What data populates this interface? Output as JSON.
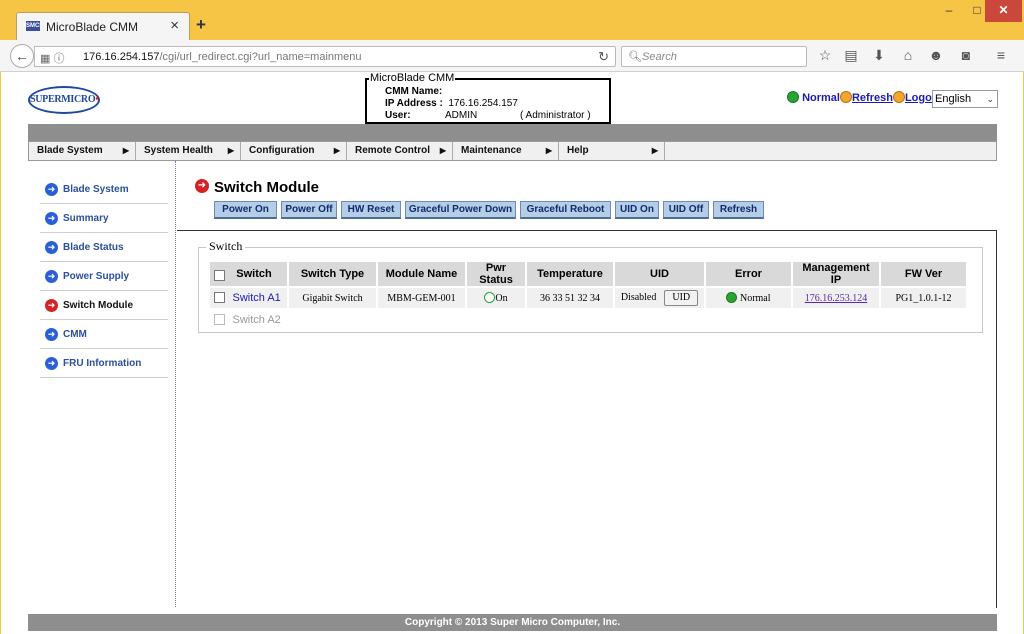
{
  "browser": {
    "tab_title": "MicroBlade CMM",
    "tab_favicon_text": "SMCI",
    "tab_close": "×",
    "new_tab": "+",
    "url_host": "176.16.254.157",
    "url_path": "/cgi/url_redirect.cgi?url_name=mainmenu",
    "search_placeholder": "Search",
    "window_controls": {
      "minimize": "–",
      "maximize": "□",
      "close": "✕"
    }
  },
  "header": {
    "logo_text": "SUPERMICRO",
    "info_legend": "MicroBlade CMM",
    "cmm_name_label": "CMM Name:",
    "cmm_name_value": "",
    "ip_label": "IP Address :",
    "ip_value": "176.16.254.157",
    "user_label": "User:",
    "user_value": "ADMIN",
    "user_role": "( Administrator )",
    "status_text": "Normal",
    "refresh_label": "Refresh",
    "logout_label": "Logout",
    "language": "English"
  },
  "menu": {
    "items": [
      {
        "label": "Blade System"
      },
      {
        "label": "System Health"
      },
      {
        "label": "Configuration"
      },
      {
        "label": "Remote Control"
      },
      {
        "label": "Maintenance"
      },
      {
        "label": "Help"
      }
    ]
  },
  "sidebar": {
    "items": [
      {
        "label": "Blade System",
        "active": false
      },
      {
        "label": "Summary",
        "active": false
      },
      {
        "label": "Blade Status",
        "active": false
      },
      {
        "label": "Power Supply",
        "active": false
      },
      {
        "label": "Switch Module",
        "active": true
      },
      {
        "label": "CMM",
        "active": false
      },
      {
        "label": "FRU Information",
        "active": false
      }
    ]
  },
  "main": {
    "title": "Switch Module",
    "actions": [
      {
        "label": "Power On"
      },
      {
        "label": "Power Off"
      },
      {
        "label": "HW Reset"
      },
      {
        "label": "Graceful Power Down"
      },
      {
        "label": "Graceful Reboot"
      },
      {
        "label": "UID On"
      },
      {
        "label": "UID Off"
      },
      {
        "label": "Refresh"
      }
    ],
    "fieldset_legend": "Switch",
    "table": {
      "headers": [
        "Switch",
        "Switch Type",
        "Module Name",
        "Pwr Status",
        "Temperature",
        "UID",
        "Error",
        "Management IP",
        "FW Ver"
      ],
      "rows": [
        {
          "switch": "Switch A1",
          "type": "Gigabit Switch",
          "module_name": "MBM-GEM-001",
          "pwr_status": "On",
          "temperature": "36 33 51 32 34",
          "uid_state": "Disabled",
          "uid_button": "UID",
          "error": "Normal",
          "mgmt_ip": "176.16.253.124",
          "fw_ver": "PG1_1.0.1-12"
        },
        {
          "switch": "Switch A2"
        }
      ]
    }
  },
  "footer": {
    "copyright": "Copyright © 2013 Super Micro Computer, Inc."
  }
}
